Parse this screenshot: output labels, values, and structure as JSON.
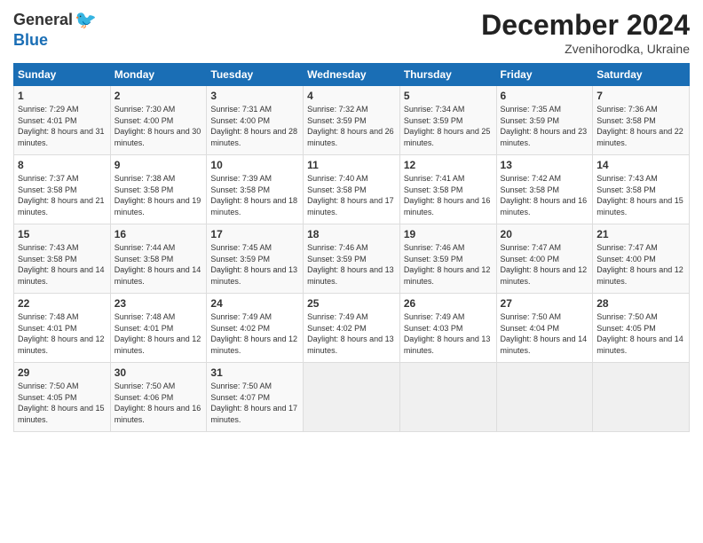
{
  "logo": {
    "general": "General",
    "blue": "Blue"
  },
  "header": {
    "month": "December 2024",
    "location": "Zvenihorodka, Ukraine"
  },
  "weekdays": [
    "Sunday",
    "Monday",
    "Tuesday",
    "Wednesday",
    "Thursday",
    "Friday",
    "Saturday"
  ],
  "weeks": [
    [
      {
        "day": "1",
        "sunrise": "7:29 AM",
        "sunset": "4:01 PM",
        "daylight": "8 hours and 31 minutes."
      },
      {
        "day": "2",
        "sunrise": "7:30 AM",
        "sunset": "4:00 PM",
        "daylight": "8 hours and 30 minutes."
      },
      {
        "day": "3",
        "sunrise": "7:31 AM",
        "sunset": "4:00 PM",
        "daylight": "8 hours and 28 minutes."
      },
      {
        "day": "4",
        "sunrise": "7:32 AM",
        "sunset": "3:59 PM",
        "daylight": "8 hours and 26 minutes."
      },
      {
        "day": "5",
        "sunrise": "7:34 AM",
        "sunset": "3:59 PM",
        "daylight": "8 hours and 25 minutes."
      },
      {
        "day": "6",
        "sunrise": "7:35 AM",
        "sunset": "3:59 PM",
        "daylight": "8 hours and 23 minutes."
      },
      {
        "day": "7",
        "sunrise": "7:36 AM",
        "sunset": "3:58 PM",
        "daylight": "8 hours and 22 minutes."
      }
    ],
    [
      {
        "day": "8",
        "sunrise": "7:37 AM",
        "sunset": "3:58 PM",
        "daylight": "8 hours and 21 minutes."
      },
      {
        "day": "9",
        "sunrise": "7:38 AM",
        "sunset": "3:58 PM",
        "daylight": "8 hours and 19 minutes."
      },
      {
        "day": "10",
        "sunrise": "7:39 AM",
        "sunset": "3:58 PM",
        "daylight": "8 hours and 18 minutes."
      },
      {
        "day": "11",
        "sunrise": "7:40 AM",
        "sunset": "3:58 PM",
        "daylight": "8 hours and 17 minutes."
      },
      {
        "day": "12",
        "sunrise": "7:41 AM",
        "sunset": "3:58 PM",
        "daylight": "8 hours and 16 minutes."
      },
      {
        "day": "13",
        "sunrise": "7:42 AM",
        "sunset": "3:58 PM",
        "daylight": "8 hours and 16 minutes."
      },
      {
        "day": "14",
        "sunrise": "7:43 AM",
        "sunset": "3:58 PM",
        "daylight": "8 hours and 15 minutes."
      }
    ],
    [
      {
        "day": "15",
        "sunrise": "7:43 AM",
        "sunset": "3:58 PM",
        "daylight": "8 hours and 14 minutes."
      },
      {
        "day": "16",
        "sunrise": "7:44 AM",
        "sunset": "3:58 PM",
        "daylight": "8 hours and 14 minutes."
      },
      {
        "day": "17",
        "sunrise": "7:45 AM",
        "sunset": "3:59 PM",
        "daylight": "8 hours and 13 minutes."
      },
      {
        "day": "18",
        "sunrise": "7:46 AM",
        "sunset": "3:59 PM",
        "daylight": "8 hours and 13 minutes."
      },
      {
        "day": "19",
        "sunrise": "7:46 AM",
        "sunset": "3:59 PM",
        "daylight": "8 hours and 12 minutes."
      },
      {
        "day": "20",
        "sunrise": "7:47 AM",
        "sunset": "4:00 PM",
        "daylight": "8 hours and 12 minutes."
      },
      {
        "day": "21",
        "sunrise": "7:47 AM",
        "sunset": "4:00 PM",
        "daylight": "8 hours and 12 minutes."
      }
    ],
    [
      {
        "day": "22",
        "sunrise": "7:48 AM",
        "sunset": "4:01 PM",
        "daylight": "8 hours and 12 minutes."
      },
      {
        "day": "23",
        "sunrise": "7:48 AM",
        "sunset": "4:01 PM",
        "daylight": "8 hours and 12 minutes."
      },
      {
        "day": "24",
        "sunrise": "7:49 AM",
        "sunset": "4:02 PM",
        "daylight": "8 hours and 12 minutes."
      },
      {
        "day": "25",
        "sunrise": "7:49 AM",
        "sunset": "4:02 PM",
        "daylight": "8 hours and 13 minutes."
      },
      {
        "day": "26",
        "sunrise": "7:49 AM",
        "sunset": "4:03 PM",
        "daylight": "8 hours and 13 minutes."
      },
      {
        "day": "27",
        "sunrise": "7:50 AM",
        "sunset": "4:04 PM",
        "daylight": "8 hours and 14 minutes."
      },
      {
        "day": "28",
        "sunrise": "7:50 AM",
        "sunset": "4:05 PM",
        "daylight": "8 hours and 14 minutes."
      }
    ],
    [
      {
        "day": "29",
        "sunrise": "7:50 AM",
        "sunset": "4:05 PM",
        "daylight": "8 hours and 15 minutes."
      },
      {
        "day": "30",
        "sunrise": "7:50 AM",
        "sunset": "4:06 PM",
        "daylight": "8 hours and 16 minutes."
      },
      {
        "day": "31",
        "sunrise": "7:50 AM",
        "sunset": "4:07 PM",
        "daylight": "8 hours and 17 minutes."
      },
      null,
      null,
      null,
      null
    ]
  ],
  "labels": {
    "sunrise": "Sunrise: ",
    "sunset": "Sunset: ",
    "daylight": "Daylight: "
  }
}
